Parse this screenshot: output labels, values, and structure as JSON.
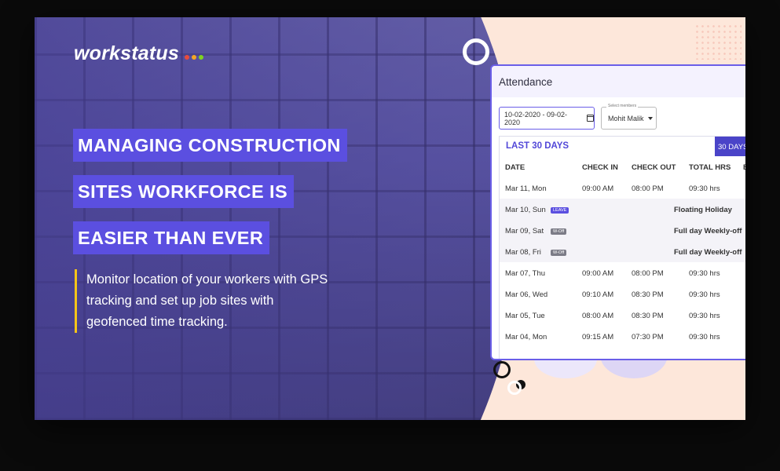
{
  "brand": {
    "name": "workstatus",
    "dot_colors": [
      "#e74c3c",
      "#f5a623",
      "#7ed321"
    ]
  },
  "hero": {
    "headline_lines": [
      "MANAGING CONSTRUCTION",
      "SITES WORKFORCE IS",
      "EASIER THAN EVER"
    ],
    "description": "Monitor location of your workers with GPS tracking and set up job sites with geofenced time tracking."
  },
  "attendance": {
    "title": "Attendance",
    "date_range": "10-02-2020 - 09-02-2020",
    "member_select_label": "Select members",
    "member_value": "Mohit Malik",
    "range_label": "LAST 30 DAYS",
    "range_button": "30 DAYS",
    "columns": [
      "DATE",
      "CHECK IN",
      "CHECK OUT",
      "TOTAL HRS",
      "B"
    ],
    "rows": [
      {
        "date": "Mar 11, Mon",
        "tag": "",
        "check_in": "09:00 AM",
        "check_out": "08:00 PM",
        "total": "09:30 hrs",
        "note": ""
      },
      {
        "date": "Mar 10, Sun",
        "tag": "LEAVE",
        "check_in": "",
        "check_out": "",
        "total": "",
        "note": "Floating Holiday"
      },
      {
        "date": "Mar 09, Sat",
        "tag": "W-Off",
        "check_in": "",
        "check_out": "",
        "total": "",
        "note": "Full day Weekly-off"
      },
      {
        "date": "Mar 08, Fri",
        "tag": "W-Off",
        "check_in": "",
        "check_out": "",
        "total": "",
        "note": "Full day Weekly-off"
      },
      {
        "date": "Mar 07, Thu",
        "tag": "",
        "check_in": "09:00 AM",
        "check_out": "08:00 PM",
        "total": "09:30 hrs",
        "note": ""
      },
      {
        "date": "Mar 06, Wed",
        "tag": "",
        "check_in": "09:10 AM",
        "check_out": "08:30 PM",
        "total": "09:30 hrs",
        "note": ""
      },
      {
        "date": "Mar 05, Tue",
        "tag": "",
        "check_in": "08:00 AM",
        "check_out": "08:30 PM",
        "total": "09:30 hrs",
        "note": ""
      },
      {
        "date": "Mar 04, Mon",
        "tag": "",
        "check_in": "09:15 AM",
        "check_out": "07:30 PM",
        "total": "09:30 hrs",
        "note": ""
      }
    ]
  },
  "colors": {
    "accent": "#5b4fe0",
    "highlight_bar": "#f5c518",
    "background_peach": "#fde7da"
  }
}
